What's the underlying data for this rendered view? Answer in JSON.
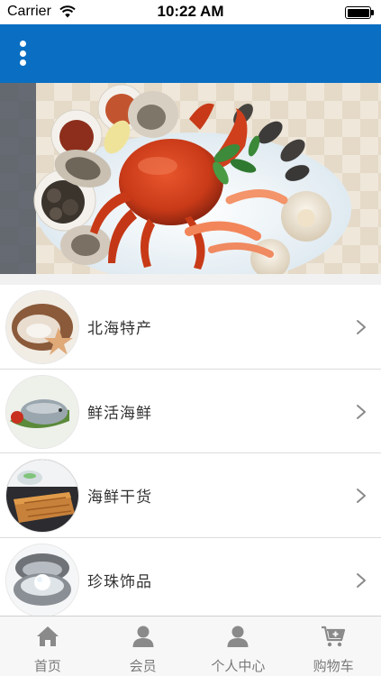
{
  "status_bar": {
    "carrier": "Carrier",
    "time": "10:22 AM"
  },
  "nav_bar": {
    "menu_icon": "more-vertical-icon",
    "background_color": "#0a6fc2"
  },
  "banner": {
    "image": "seafood-platter-crab-shrimp-oysters",
    "page_count": 3,
    "active_page": 1
  },
  "categories": [
    {
      "label": "北海特产",
      "icon": "scallop-starfish-thumbnail"
    },
    {
      "label": "鲜活海鲜",
      "icon": "fresh-fish-thumbnail"
    },
    {
      "label": "海鲜干货",
      "icon": "dried-seafood-thumbnail"
    },
    {
      "label": "珍珠饰品",
      "icon": "pearl-oyster-thumbnail"
    }
  ],
  "tab_bar": {
    "tabs": [
      {
        "label": "首页",
        "icon": "home-icon"
      },
      {
        "label": "会员",
        "icon": "user-icon"
      },
      {
        "label": "个人中心",
        "icon": "user-icon"
      },
      {
        "label": "购物车",
        "icon": "cart-add-icon"
      }
    ]
  }
}
